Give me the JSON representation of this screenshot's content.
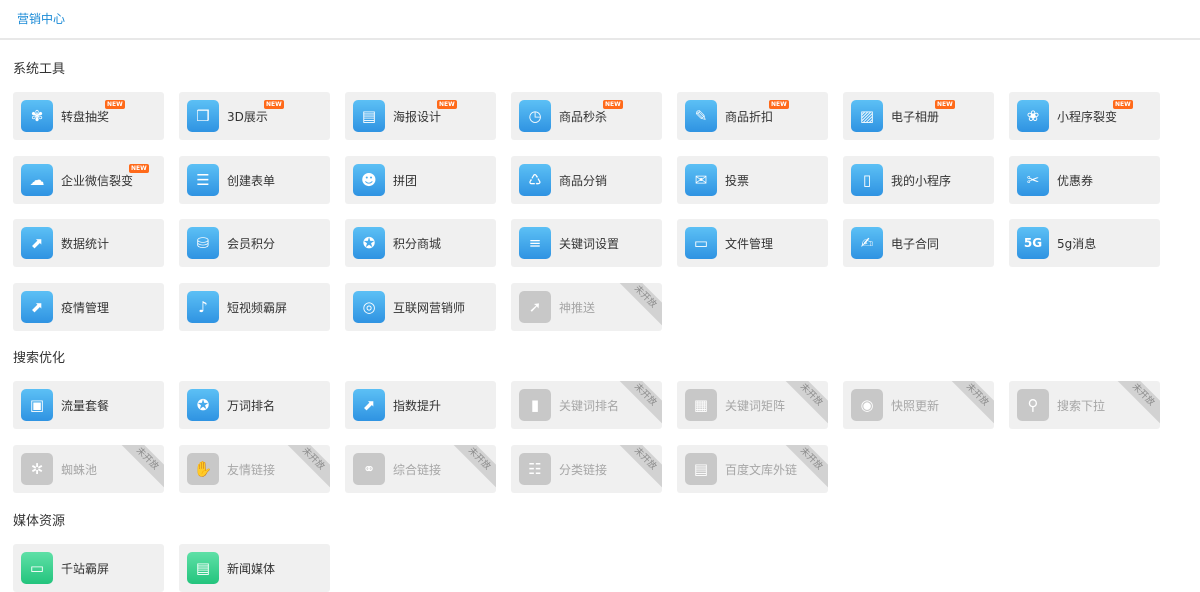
{
  "header": {
    "title": "营销中心"
  },
  "badges": {
    "new": "NEW",
    "unavailable": "未开放"
  },
  "sections": [
    {
      "title": "系统工具",
      "items": [
        {
          "label": "转盘抽奖",
          "icon": "wheel-icon",
          "glyph": "✾",
          "new": true
        },
        {
          "label": "3D展示",
          "icon": "3d-display-icon",
          "glyph": "❒",
          "new": true
        },
        {
          "label": "海报设计",
          "icon": "poster-icon",
          "glyph": "▤",
          "new": true
        },
        {
          "label": "商品秒杀",
          "icon": "flash-sale-icon",
          "glyph": "◷",
          "new": true
        },
        {
          "label": "商品折扣",
          "icon": "discount-tag-icon",
          "glyph": "✎",
          "new": true
        },
        {
          "label": "电子相册",
          "icon": "photo-album-icon",
          "glyph": "▨",
          "new": true
        },
        {
          "label": "小程序裂变",
          "icon": "mini-program-fission-icon",
          "glyph": "❀",
          "new": true
        },
        {
          "label": "企业微信裂变",
          "icon": "wechat-work-icon",
          "glyph": "☁",
          "new": true
        },
        {
          "label": "创建表单",
          "icon": "form-icon",
          "glyph": "☰"
        },
        {
          "label": "拼团",
          "icon": "group-buy-icon",
          "glyph": "☻"
        },
        {
          "label": "商品分销",
          "icon": "distribution-icon",
          "glyph": "♺"
        },
        {
          "label": "投票",
          "icon": "vote-icon",
          "glyph": "✉"
        },
        {
          "label": "我的小程序",
          "icon": "mini-program-icon",
          "glyph": "▯"
        },
        {
          "label": "优惠券",
          "icon": "coupon-icon",
          "glyph": "✂"
        },
        {
          "label": "数据统计",
          "icon": "statistics-icon",
          "glyph": "⬈"
        },
        {
          "label": "会员积分",
          "icon": "member-points-icon",
          "glyph": "⛁"
        },
        {
          "label": "积分商城",
          "icon": "points-mall-icon",
          "glyph": "✪"
        },
        {
          "label": "关键词设置",
          "icon": "keyword-settings-icon",
          "glyph": "≡"
        },
        {
          "label": "文件管理",
          "icon": "folder-icon",
          "glyph": "▭"
        },
        {
          "label": "电子合同",
          "icon": "contract-icon",
          "glyph": "✍"
        },
        {
          "label": "5g消息",
          "icon": "5g-message-icon",
          "glyph": "5G"
        },
        {
          "label": "疫情管理",
          "icon": "epidemic-chart-icon",
          "glyph": "⬈"
        },
        {
          "label": "短视频霸屏",
          "icon": "short-video-icon",
          "glyph": "♪"
        },
        {
          "label": "互联网营销师",
          "icon": "internet-marketer-icon",
          "glyph": "◎"
        },
        {
          "label": "神推送",
          "icon": "push-icon",
          "glyph": "➚",
          "disabled": true
        }
      ]
    },
    {
      "title": "搜索优化",
      "items": [
        {
          "label": "流量套餐",
          "icon": "traffic-package-icon",
          "glyph": "▣"
        },
        {
          "label": "万词排名",
          "icon": "ranking-medal-icon",
          "glyph": "✪"
        },
        {
          "label": "指数提升",
          "icon": "index-growth-icon",
          "glyph": "⬈"
        },
        {
          "label": "关键词排名",
          "icon": "keyword-ranking-icon",
          "glyph": "▮",
          "disabled": true
        },
        {
          "label": "关键词矩阵",
          "icon": "keyword-matrix-icon",
          "glyph": "▦",
          "disabled": true
        },
        {
          "label": "快照更新",
          "icon": "snapshot-camera-icon",
          "glyph": "◉",
          "disabled": true
        },
        {
          "label": "搜索下拉",
          "icon": "search-dropdown-icon",
          "glyph": "⚲",
          "disabled": true
        },
        {
          "label": "蜘蛛池",
          "icon": "spider-pool-icon",
          "glyph": "✲",
          "disabled": true
        },
        {
          "label": "友情链接",
          "icon": "friend-link-icon",
          "glyph": "✋",
          "disabled": true
        },
        {
          "label": "综合链接",
          "icon": "chain-link-icon",
          "glyph": "⚭",
          "disabled": true
        },
        {
          "label": "分类链接",
          "icon": "category-link-icon",
          "glyph": "☷",
          "disabled": true
        },
        {
          "label": "百度文库外链",
          "icon": "baidu-library-icon",
          "glyph": "▤",
          "disabled": true
        }
      ]
    },
    {
      "title": "媒体资源",
      "items": [
        {
          "label": "千站霸屏",
          "icon": "monitor-icon",
          "glyph": "▭",
          "green": true
        },
        {
          "label": "新闻媒体",
          "icon": "news-document-icon",
          "glyph": "▤",
          "green": true
        }
      ]
    }
  ]
}
